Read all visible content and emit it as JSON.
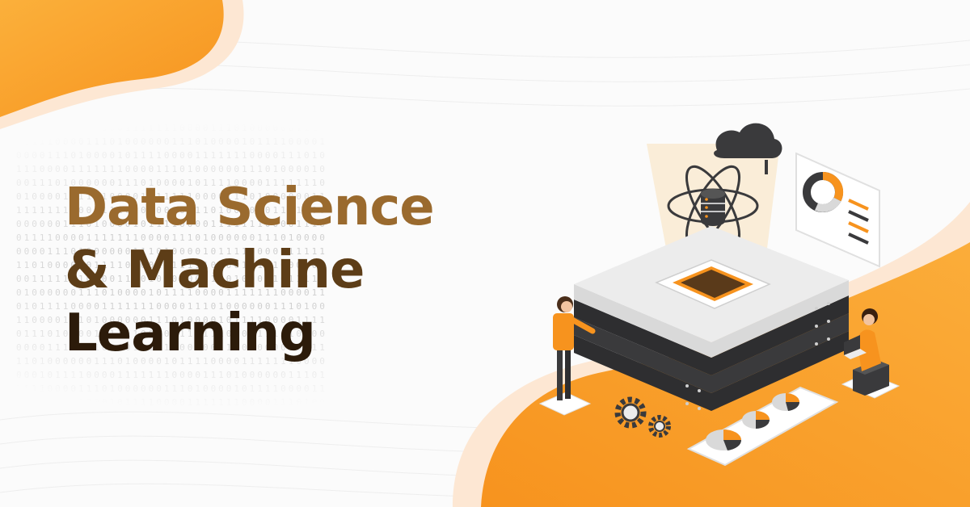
{
  "headline": {
    "line_1": "Data Science",
    "line_2": "& Machine",
    "line_3": "Learning"
  },
  "colors": {
    "accent_orange": "#f7931e",
    "accent_orange_light": "#fbb03b",
    "peach": "#fde7d3",
    "headline_top": "#9a6a2e",
    "headline_mid": "#5d3d17",
    "headline_bottom": "#2c1b0a",
    "server_dark": "#3a3a3c",
    "server_light": "#ececec"
  },
  "illustration": {
    "icons": [
      "cloud-icon",
      "atom-icon",
      "database-icon",
      "donut-chart-icon",
      "pie-chart-icon",
      "gear-icon",
      "laptop-icon"
    ],
    "figures": [
      "man-standing",
      "woman-sitting-with-laptop"
    ]
  },
  "binary_pattern": "0 1 0 0 1 1 0 1 0 0 1 0 1 1 0 0 1 0 1 1 0 1 0 0 1 0 1 1 0 1 0 0 1 0 1 0 0 1 1 0 1"
}
